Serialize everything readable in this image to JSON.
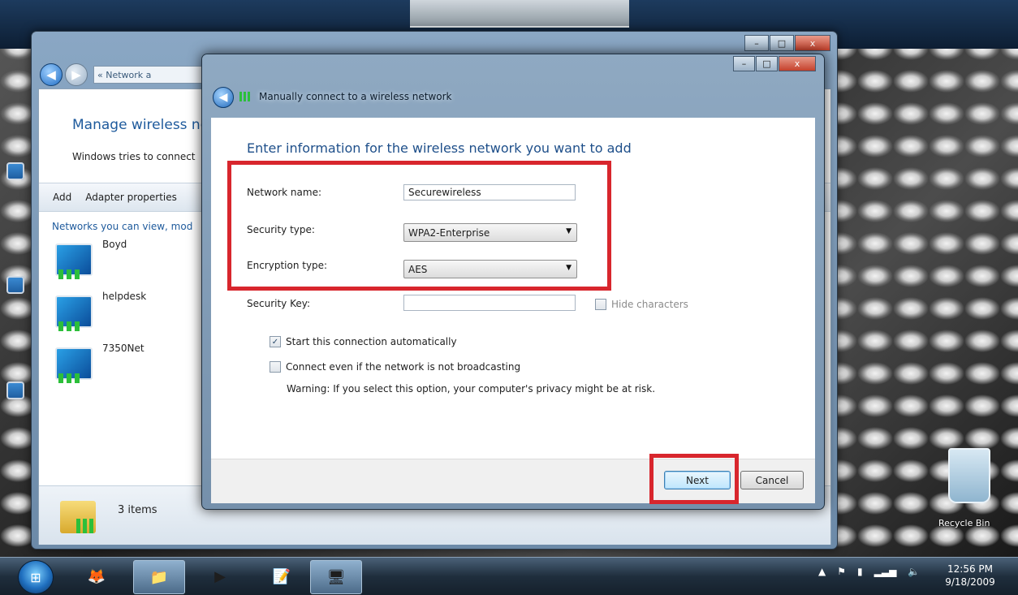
{
  "background_window": {
    "breadcrumb": "« Network a",
    "heading": "Manage wireless ne",
    "subtext": "Windows tries to connect",
    "toolbar": [
      "Add",
      "Adapter properties"
    ],
    "list_header": "Networks you can view, mod",
    "networks": [
      "Boyd",
      "helpdesk",
      "7350Net"
    ],
    "status_count": "3 items",
    "title_buttons": [
      "–",
      "□",
      "x"
    ]
  },
  "dialog": {
    "title": "Manually connect to a wireless network",
    "heading": "Enter information for the wireless network you want to add",
    "network_name_label": "Network name:",
    "network_name_value": "Securewireless",
    "security_type_label": "Security type:",
    "security_type_value": "WPA2-Enterprise",
    "encryption_type_label": "Encryption type:",
    "encryption_type_value": "AES",
    "security_key_label": "Security Key:",
    "security_key_value": "",
    "hide_characters_label": "Hide characters",
    "hide_characters_checked": false,
    "start_auto_label": "Start this connection automatically",
    "start_auto_checked": true,
    "connect_even_label": "Connect even if the network is not broadcasting",
    "connect_even_checked": false,
    "warning": "Warning: If you select this option, your computer's privacy might be at risk.",
    "next_label": "Next",
    "cancel_label": "Cancel",
    "title_buttons": [
      "–",
      "□",
      "x"
    ]
  },
  "desktop": {
    "recycle_bin_label": "Recycle Bin"
  },
  "taskbar": {
    "time": "12:56 PM",
    "date": "9/18/2009",
    "tray_icons": [
      "show-hidden-icon",
      "flag-icon",
      "battery-icon",
      "signal-icon",
      "volume-icon"
    ]
  },
  "colors": {
    "highlight_red": "#d8262d",
    "heading_blue": "#1e4f8a",
    "link_blue": "#1e5a9c"
  }
}
